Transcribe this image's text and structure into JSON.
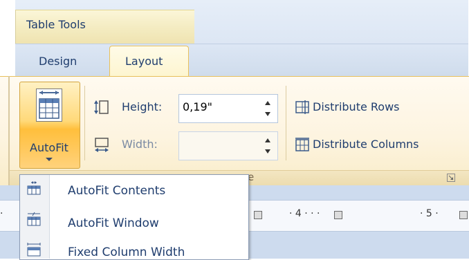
{
  "ribbon": {
    "context_group": "Table Tools",
    "tabs": [
      {
        "label": "Design"
      },
      {
        "label": "Layout"
      }
    ],
    "autofit_label": "AutoFit",
    "height_label": "Height:",
    "height_value": "0,19\"",
    "width_label": "Width:",
    "width_value": "",
    "distribute_rows_label": "Distribute Rows",
    "distribute_columns_label": "Distribute Columns",
    "group_label_fragment": "e"
  },
  "ruler": {
    "start_mark": "·",
    "label_4": "· 4 · · ·",
    "label_5": "· 5 ·"
  },
  "autofit_menu": {
    "items": [
      {
        "label": "AutoFit Contents",
        "icon": "autofit-contents-icon"
      },
      {
        "label": "AutoFit Window",
        "icon": "autofit-window-icon"
      },
      {
        "label": "Fixed Column Width",
        "icon": "fixed-column-width-icon"
      }
    ]
  },
  "colors": {
    "tab_text": "#1f3d6e",
    "active_tab_border": "#e8c05c",
    "autofit_highlight": "#ffbf3c"
  }
}
